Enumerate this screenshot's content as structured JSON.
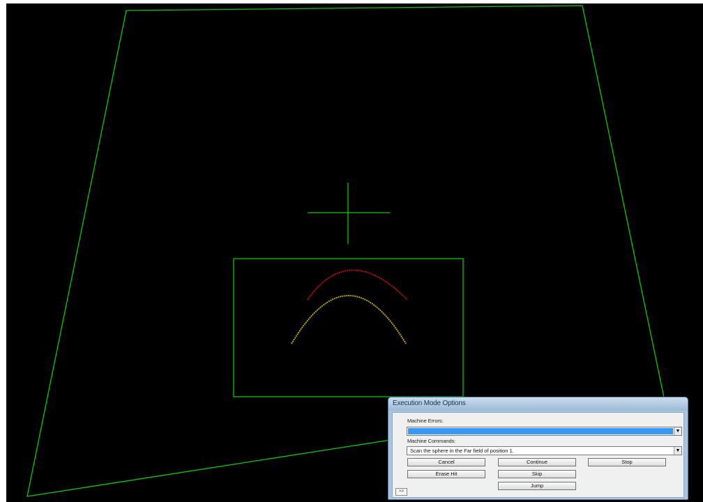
{
  "viewport": {
    "background": "#000000",
    "line_color": "#00cc00",
    "arc_upper_color": "#b01010",
    "arc_lower_color": "#b8a800",
    "crosshair_icon": "crosshair-icon"
  },
  "dialog": {
    "title": "Execution Mode Options",
    "machine_errors_label": "Machine Errors:",
    "machine_errors_value": "",
    "machine_commands_label": "Machine Commands:",
    "machine_commands_value": "Scan the sphere in the Far field of position 1.",
    "buttons": {
      "cancel": "Cancel",
      "continue": "Continue",
      "stop": "Stop",
      "erase_hit": "Erase Hit",
      "skip": "Skip",
      "jump": "Jump"
    },
    "expander_label": ">>",
    "dropdown_glyph": "▼"
  }
}
